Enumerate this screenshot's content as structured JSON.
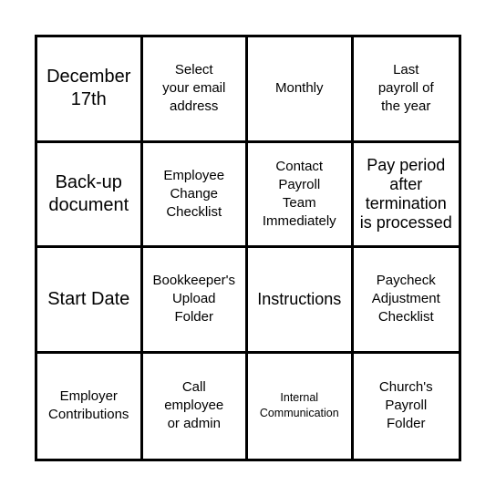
{
  "bingo": {
    "cells": [
      {
        "text": "December\n17th",
        "size": "xl"
      },
      {
        "text": "Select\nyour email\naddress",
        "size": "md"
      },
      {
        "text": "Monthly",
        "size": "md"
      },
      {
        "text": "Last\npayroll of\nthe year",
        "size": "md"
      },
      {
        "text": "Back-up\ndocument",
        "size": "xl"
      },
      {
        "text": "Employee\nChange\nChecklist",
        "size": "md"
      },
      {
        "text": "Contact\nPayroll\nTeam\nImmediately",
        "size": "md"
      },
      {
        "text": "Pay period\nafter\ntermination\nis processed",
        "size": "lg"
      },
      {
        "text": "Start Date",
        "size": "xl"
      },
      {
        "text": "Bookkeeper's\nUpload\nFolder",
        "size": "md"
      },
      {
        "text": "Instructions",
        "size": "lg"
      },
      {
        "text": "Paycheck\nAdjustment\nChecklist",
        "size": "md"
      },
      {
        "text": "Employer\nContributions",
        "size": "md"
      },
      {
        "text": "Call\nemployee\nor admin",
        "size": "md"
      },
      {
        "text": "Internal\nCommunication",
        "size": "xs"
      },
      {
        "text": "Church's\nPayroll\nFolder",
        "size": "md"
      }
    ]
  }
}
